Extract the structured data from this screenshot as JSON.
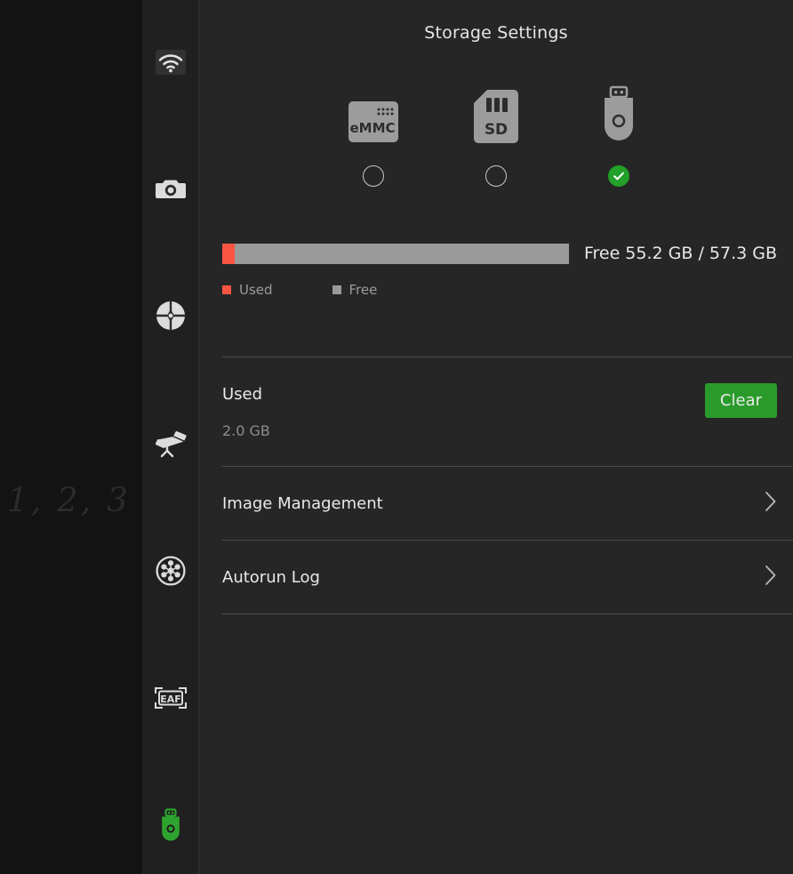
{
  "header": {
    "title": "Storage Settings"
  },
  "left_panel": {
    "watermark": "1, 2, 3"
  },
  "sidebar": {
    "items": [
      {
        "name": "wifi-icon",
        "label": "WiFi"
      },
      {
        "name": "camera-icon",
        "label": "Camera"
      },
      {
        "name": "focuser-target-icon",
        "label": "Focus Target"
      },
      {
        "name": "telescope-icon",
        "label": "Telescope"
      },
      {
        "name": "filter-wheel-icon",
        "label": "Filter Wheel"
      },
      {
        "name": "eaf-icon",
        "label": "EAF"
      },
      {
        "name": "usb-storage-icon",
        "label": "USB Storage"
      }
    ],
    "active_index": 6,
    "active_color": "#2fa32f"
  },
  "devices": {
    "options": [
      {
        "id": "emmc",
        "label": "eMMC",
        "selected": false
      },
      {
        "id": "sd",
        "label": "SD",
        "selected": false
      },
      {
        "id": "usb",
        "label": "USB",
        "selected": true
      }
    ],
    "selected_id": "usb",
    "check_color": "#22a02a"
  },
  "capacity": {
    "summary": "Free 55.2 GB / 57.3 GB",
    "free_gb": 55.2,
    "total_gb": 57.3,
    "used_gb": 2.0,
    "used_percent": 3.5,
    "used_color": "#fa5543",
    "free_color": "#9a9a9a",
    "legend": [
      {
        "label": "Used",
        "color": "#fa5543"
      },
      {
        "label": "Free",
        "color": "#9a9a9a"
      }
    ]
  },
  "list": {
    "used_row": {
      "title": "Used",
      "value": "2.0 GB",
      "button_label": "Clear",
      "button_color": "#2a9b2a"
    },
    "rows": [
      {
        "title": "Image Management",
        "chevron": "chevron-right-icon"
      },
      {
        "title": "Autorun Log",
        "chevron": "chevron-right-icon"
      }
    ]
  }
}
